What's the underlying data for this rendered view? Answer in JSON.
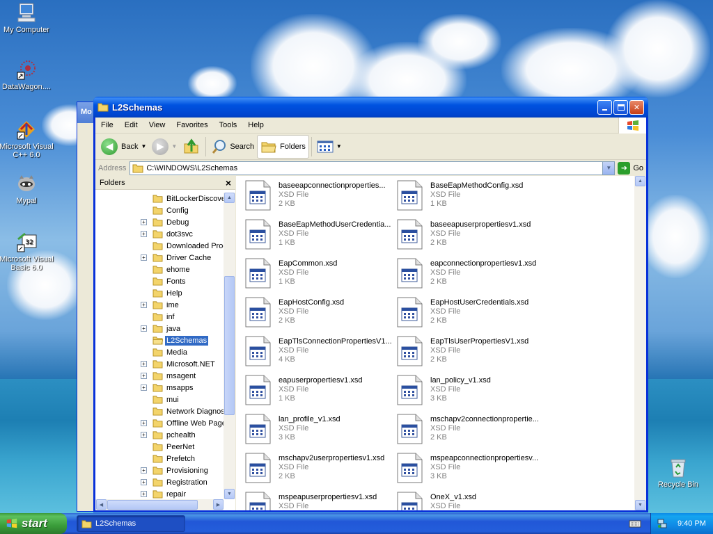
{
  "desktop": {
    "icons": [
      {
        "label": "My Computer",
        "icon": "my-computer-icon"
      },
      {
        "label": "DataWagon....",
        "icon": "datawagon-shortcut-icon"
      },
      {
        "label": "Microsoft Visual C++ 6.0",
        "icon": "visual-cpp-shortcut-icon"
      },
      {
        "label": "Mypal",
        "icon": "mypal-raccoon-icon"
      },
      {
        "label": "Microsoft Visual Basic 6.0",
        "icon": "visual-basic-shortcut-icon"
      }
    ],
    "recycle_bin": "Recycle Bin",
    "background_window_title": "Mo"
  },
  "window": {
    "title": "L2Schemas",
    "menu": [
      "File",
      "Edit",
      "View",
      "Favorites",
      "Tools",
      "Help"
    ],
    "toolbar": {
      "back": "Back",
      "search": "Search",
      "folders": "Folders"
    },
    "address": {
      "label": "Address",
      "value": "C:\\WINDOWS\\L2Schemas",
      "go": "Go"
    },
    "folders_pane": {
      "title": "Folders",
      "close": "×",
      "items": [
        {
          "label": "BitLockerDiscover",
          "expander": ""
        },
        {
          "label": "Config",
          "expander": ""
        },
        {
          "label": "Debug",
          "expander": "+"
        },
        {
          "label": "dot3svc",
          "expander": "+"
        },
        {
          "label": "Downloaded Prog",
          "expander": ""
        },
        {
          "label": "Driver Cache",
          "expander": "+"
        },
        {
          "label": "ehome",
          "expander": ""
        },
        {
          "label": "Fonts",
          "expander": ""
        },
        {
          "label": "Help",
          "expander": ""
        },
        {
          "label": "ime",
          "expander": "+"
        },
        {
          "label": "inf",
          "expander": ""
        },
        {
          "label": "java",
          "expander": "+"
        },
        {
          "label": "L2Schemas",
          "expander": "",
          "selected": true
        },
        {
          "label": "Media",
          "expander": ""
        },
        {
          "label": "Microsoft.NET",
          "expander": "+"
        },
        {
          "label": "msagent",
          "expander": "+"
        },
        {
          "label": "msapps",
          "expander": "+"
        },
        {
          "label": "mui",
          "expander": ""
        },
        {
          "label": "Network Diagnost",
          "expander": ""
        },
        {
          "label": "Offline Web Page",
          "expander": "+"
        },
        {
          "label": "pchealth",
          "expander": "+"
        },
        {
          "label": "PeerNet",
          "expander": ""
        },
        {
          "label": "Prefetch",
          "expander": ""
        },
        {
          "label": "Provisioning",
          "expander": "+"
        },
        {
          "label": "Registration",
          "expander": "+"
        },
        {
          "label": "repair",
          "expander": "+"
        }
      ]
    },
    "files": [
      {
        "name": "baseeapconnectionproperties...",
        "type": "XSD File",
        "size": "2 KB"
      },
      {
        "name": "BaseEapMethodConfig.xsd",
        "type": "XSD File",
        "size": "1 KB"
      },
      {
        "name": "BaseEapMethodUserCredentia...",
        "type": "XSD File",
        "size": "1 KB"
      },
      {
        "name": "baseeapuserpropertiesv1.xsd",
        "type": "XSD File",
        "size": "2 KB"
      },
      {
        "name": "EapCommon.xsd",
        "type": "XSD File",
        "size": "1 KB"
      },
      {
        "name": "eapconnectionpropertiesv1.xsd",
        "type": "XSD File",
        "size": "2 KB"
      },
      {
        "name": "EapHostConfig.xsd",
        "type": "XSD File",
        "size": "2 KB"
      },
      {
        "name": "EapHostUserCredentials.xsd",
        "type": "XSD File",
        "size": "2 KB"
      },
      {
        "name": "EapTlsConnectionPropertiesV1...",
        "type": "XSD File",
        "size": "4 KB"
      },
      {
        "name": "EapTlsUserPropertiesV1.xsd",
        "type": "XSD File",
        "size": "2 KB"
      },
      {
        "name": "eapuserpropertiesv1.xsd",
        "type": "XSD File",
        "size": "1 KB"
      },
      {
        "name": "lan_policy_v1.xsd",
        "type": "XSD File",
        "size": "3 KB"
      },
      {
        "name": "lan_profile_v1.xsd",
        "type": "XSD File",
        "size": "3 KB"
      },
      {
        "name": "mschapv2connectionpropertie...",
        "type": "XSD File",
        "size": "2 KB"
      },
      {
        "name": "mschapv2userpropertiesv1.xsd",
        "type": "XSD File",
        "size": "2 KB"
      },
      {
        "name": "mspeapconnectionpropertiesv...",
        "type": "XSD File",
        "size": "3 KB"
      },
      {
        "name": "mspeapuserpropertiesv1.xsd",
        "type": "XSD File",
        "size": ""
      },
      {
        "name": "OneX_v1.xsd",
        "type": "XSD File",
        "size": ""
      }
    ]
  },
  "taskbar": {
    "start": "start",
    "task": "L2Schemas",
    "clock": "9:40 PM"
  }
}
